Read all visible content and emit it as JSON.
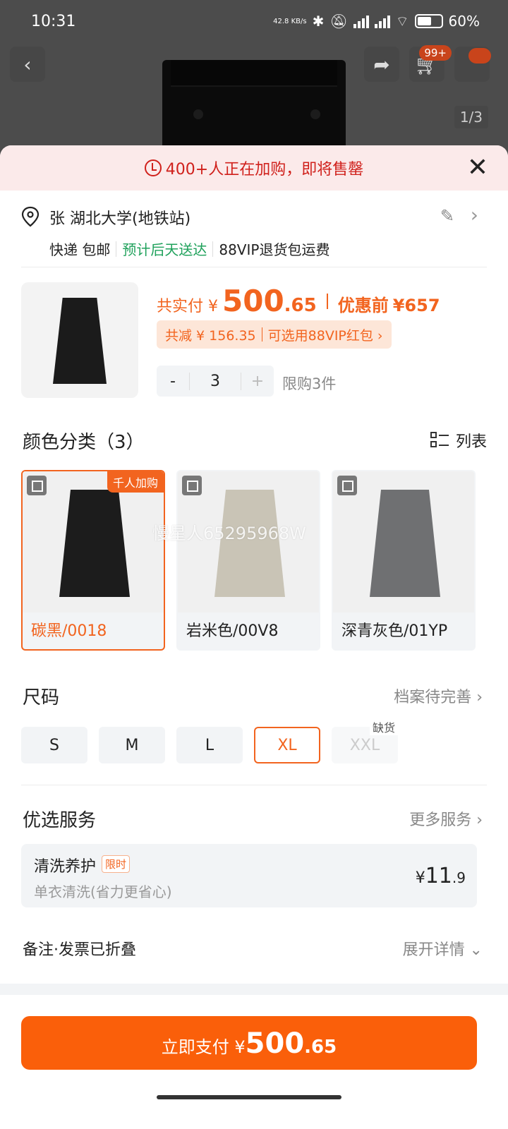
{
  "status_bar": {
    "time": "10:31",
    "net_speed": "42.8 KB/s",
    "battery": "60%"
  },
  "top_nav": {
    "cart_badge": "99+",
    "pager": "1/3"
  },
  "alert": {
    "text": "400+人正在加购，即将售罄"
  },
  "address": {
    "name": "张 湖北大学(地铁站)",
    "delivery": "快递 包邮",
    "eta": "预计后天送达",
    "return_policy": "88VIP退货包运费"
  },
  "product": {
    "pay_label": "共实付 ¥",
    "price_int": "500",
    "price_frac": ".65",
    "before_label": "优惠前",
    "before_price": "¥657",
    "discount_text": "共减 ¥ 156.35",
    "coupon_text": "可选用88VIP红包 ›",
    "quantity": "3",
    "minus": "-",
    "plus": "+",
    "limit": "限购3件"
  },
  "colors": {
    "title": "颜色分类（3）",
    "list_label": "列表",
    "hot_tag": "千人加购",
    "watermark": "慢星人65295968W",
    "items": [
      {
        "label": "碳黑/0018",
        "swatch": "#1c1c1c"
      },
      {
        "label": "岩米色/00V8",
        "swatch": "#c9c4b6"
      },
      {
        "label": "深青灰色/01YP",
        "swatch": "#6f7072"
      }
    ]
  },
  "sizes": {
    "title": "尺码",
    "hint": "档案待完善 ›",
    "items": [
      {
        "label": "S"
      },
      {
        "label": "M"
      },
      {
        "label": "L"
      },
      {
        "label": "XL"
      },
      {
        "label": "XXL"
      }
    ],
    "out_of_stock": "缺货"
  },
  "services": {
    "title": "优选服务",
    "more": "更多服务 ›",
    "item": {
      "name": "清洗养护",
      "tag": "限时",
      "desc": "单衣清洗(省力更省心)",
      "currency": "¥",
      "price_int": "11",
      "price_frac": ".9"
    }
  },
  "notes": {
    "label": "备注·发票已折叠",
    "expand": "展开详情 ⌄"
  },
  "pay_button": {
    "label": "立即支付 ¥",
    "price_int": "500",
    "price_frac": ".65"
  }
}
